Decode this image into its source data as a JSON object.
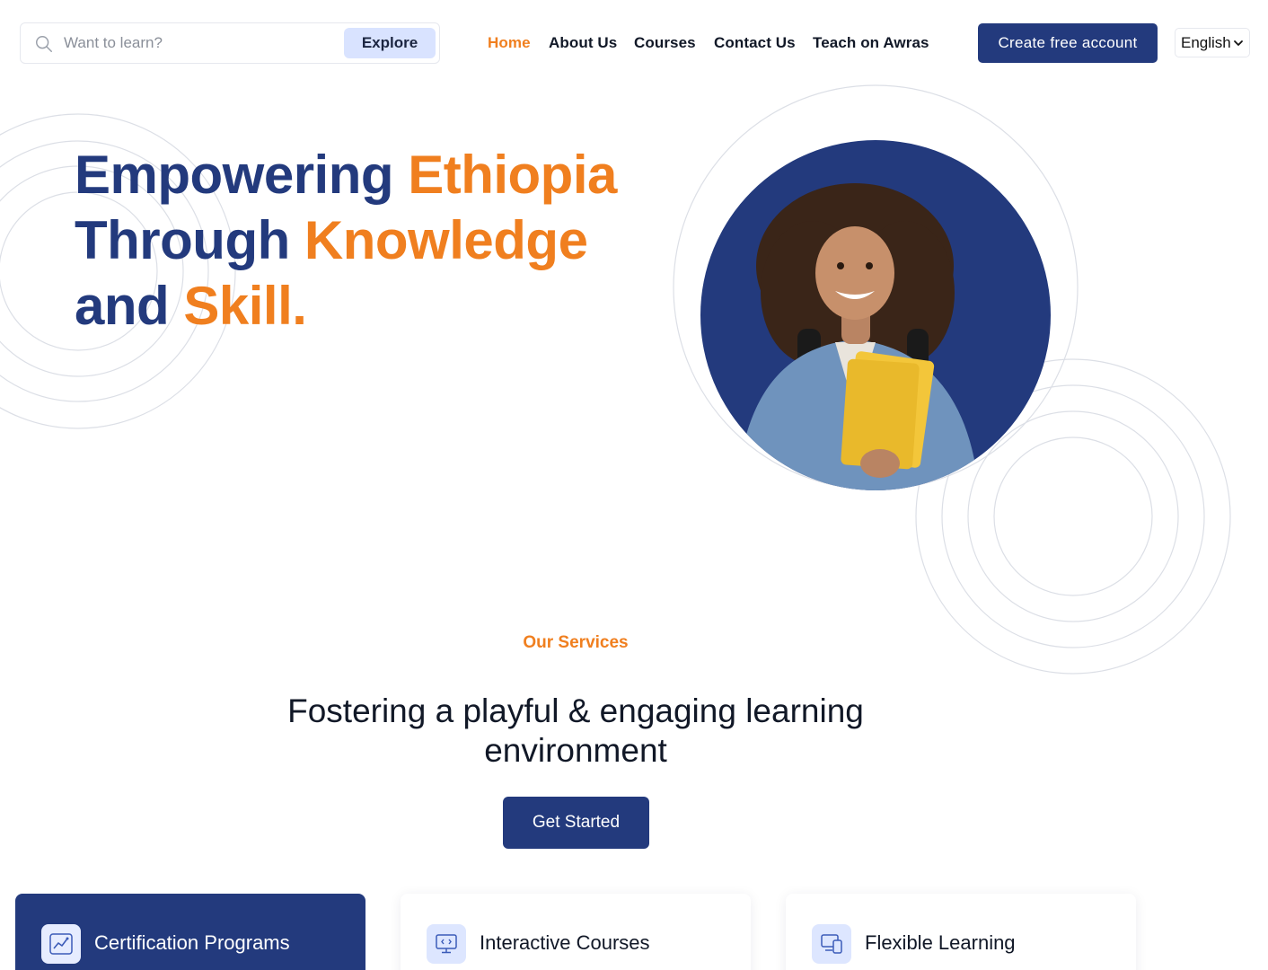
{
  "header": {
    "search": {
      "placeholder": "Want to learn?",
      "value": "",
      "button_label": "Explore"
    },
    "nav": [
      {
        "label": "Home",
        "active": true
      },
      {
        "label": "About Us",
        "active": false
      },
      {
        "label": "Courses",
        "active": false
      },
      {
        "label": "Contact Us",
        "active": false
      },
      {
        "label": "Teach on Awras",
        "active": false
      }
    ],
    "cta_label": "Create free account",
    "language": "English"
  },
  "hero": {
    "line1_main": "Empowering ",
    "line1_accent": "Ethiopia",
    "line2_main": "Through ",
    "line2_accent": "Knowledge",
    "line3_main": "and ",
    "line3_accent": "Skill."
  },
  "services": {
    "eyebrow": "Our Services",
    "heading": "Fostering a playful & engaging learning environment",
    "button_label": "Get Started",
    "cards": [
      {
        "title": "Certification Programs",
        "icon": "chart-icon",
        "featured": true
      },
      {
        "title": "Interactive Courses",
        "icon": "monitor-code-icon",
        "featured": false
      },
      {
        "title": "Flexible Learning",
        "icon": "devices-icon",
        "featured": false
      }
    ]
  },
  "colors": {
    "brand_navy": "#233a7d",
    "accent_orange": "#f07f1f",
    "soft_blue": "#d9e3ff",
    "ring_gray": "#dcdfe6"
  }
}
